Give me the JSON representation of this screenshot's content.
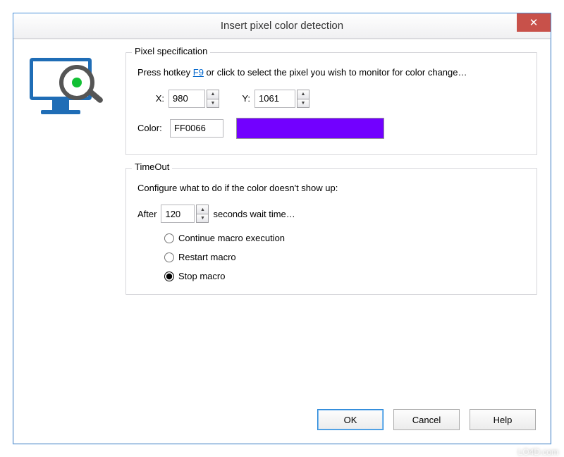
{
  "window": {
    "title": "Insert pixel color detection",
    "close_glyph": "✕"
  },
  "pixel_spec": {
    "group_title": "Pixel specification",
    "desc_prefix": "Press hotkey ",
    "hotkey": "F9",
    "desc_suffix": " or click to select the pixel you wish to monitor for color change…",
    "x_label": "X:",
    "x_value": "980",
    "y_label": "Y:",
    "y_value": "1061",
    "color_label": "Color:",
    "color_value": "FF0066",
    "swatch_color": "#7200ff"
  },
  "timeout": {
    "group_title": "TimeOut",
    "desc": "Configure what to do if the color doesn't show up:",
    "after_label": "After",
    "seconds_value": "120",
    "seconds_suffix": "seconds wait time…",
    "options": {
      "continue": "Continue macro execution",
      "restart": "Restart macro",
      "stop": "Stop macro"
    },
    "selected": "stop"
  },
  "buttons": {
    "ok": "OK",
    "cancel": "Cancel",
    "help": "Help"
  },
  "watermark": "LO4D.com"
}
